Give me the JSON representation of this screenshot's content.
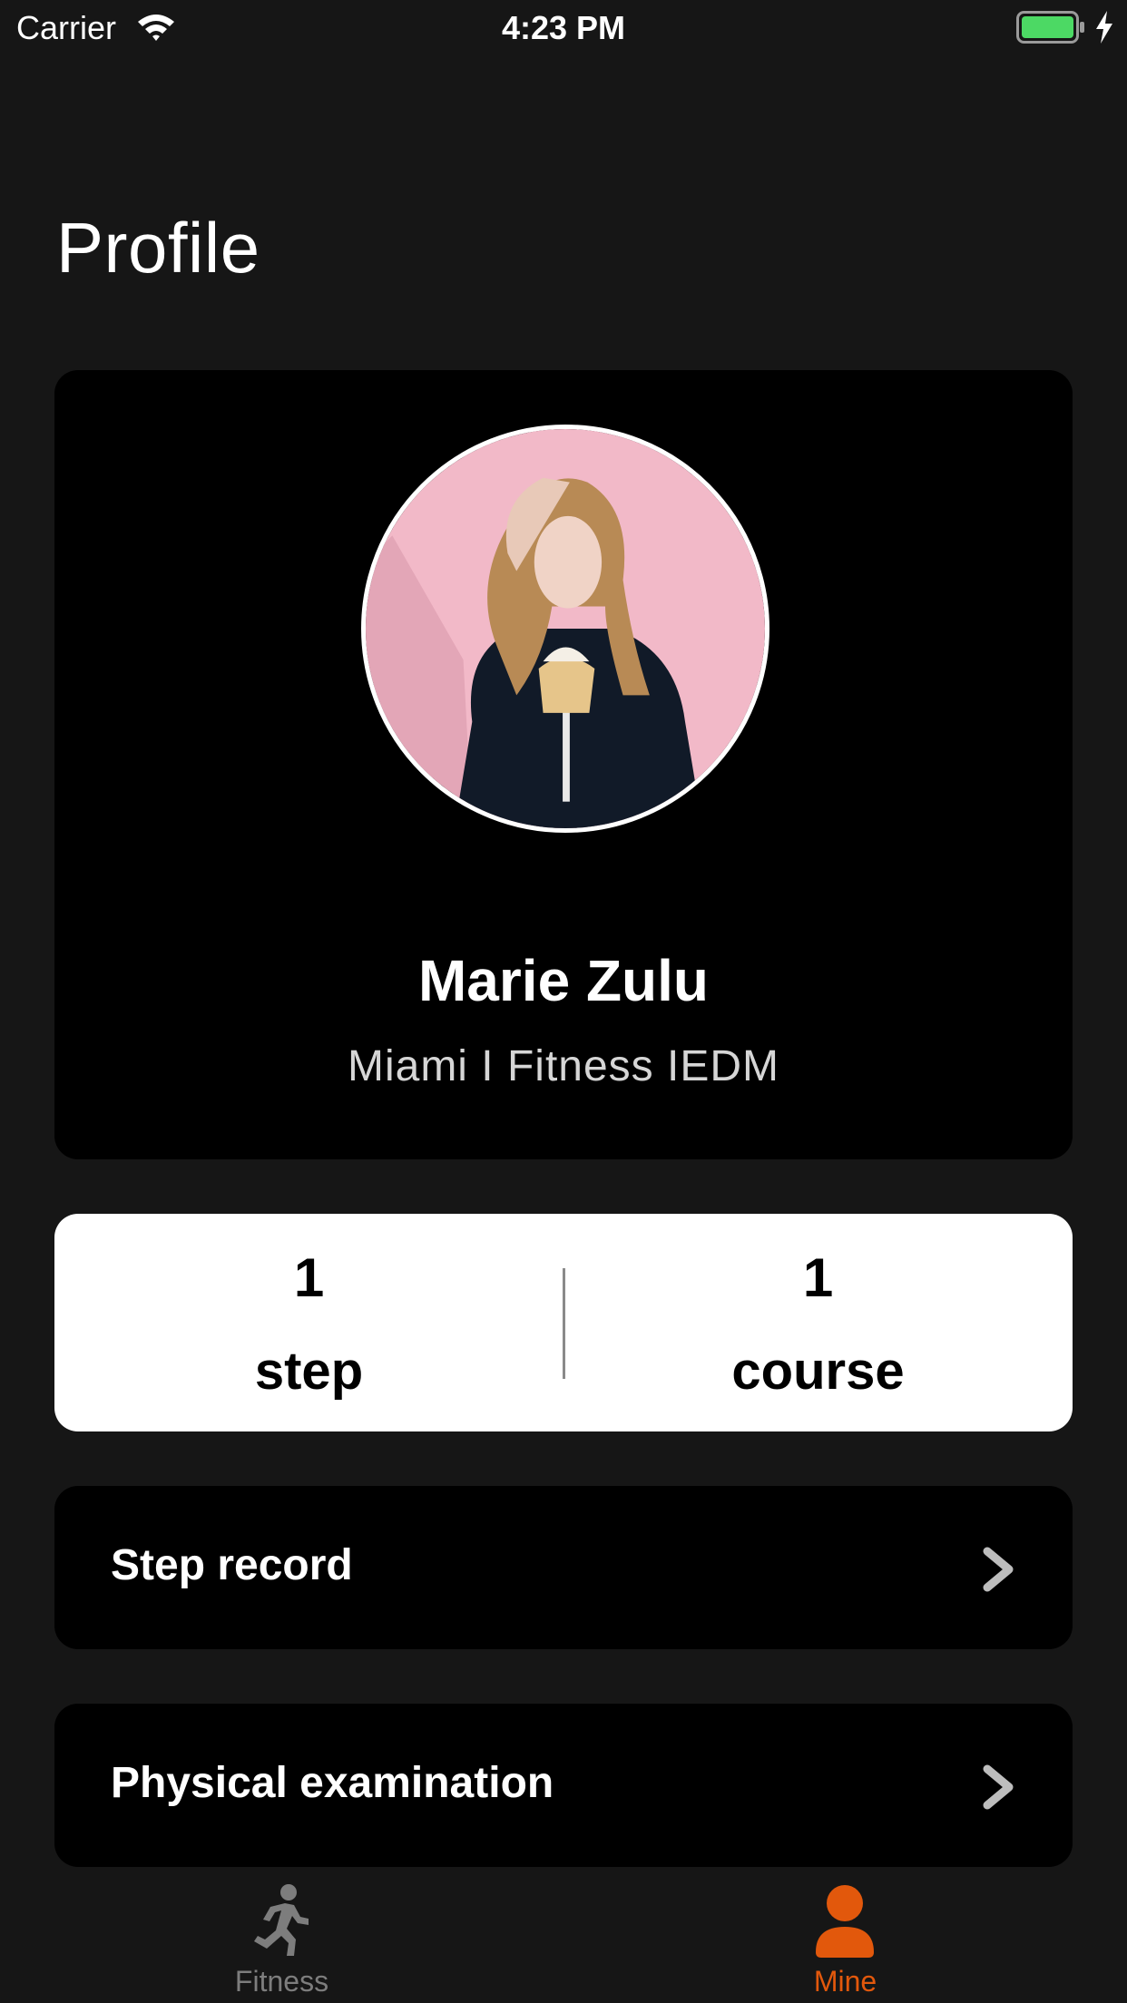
{
  "status_bar": {
    "carrier": "Carrier",
    "time": "4:23 PM",
    "battery_color": "#4cd964"
  },
  "page": {
    "title": "Profile"
  },
  "profile": {
    "name": "Marie Zulu",
    "subtitle": "Miami I Fitness IEDM"
  },
  "stats": [
    {
      "value": "1",
      "label": "step"
    },
    {
      "value": "1",
      "label": "course"
    }
  ],
  "menu": [
    {
      "label": "Step record",
      "icon": "chevron-right-icon"
    },
    {
      "label": "Physical examination",
      "icon": "chevron-right-icon"
    }
  ],
  "tab_bar": {
    "tabs": [
      {
        "label": "Fitness",
        "icon": "running-person-icon",
        "selected": false
      },
      {
        "label": "Mine",
        "icon": "person-icon",
        "selected": true
      }
    ],
    "active_color": "#e2580c",
    "inactive_color": "#7d7d7d"
  }
}
